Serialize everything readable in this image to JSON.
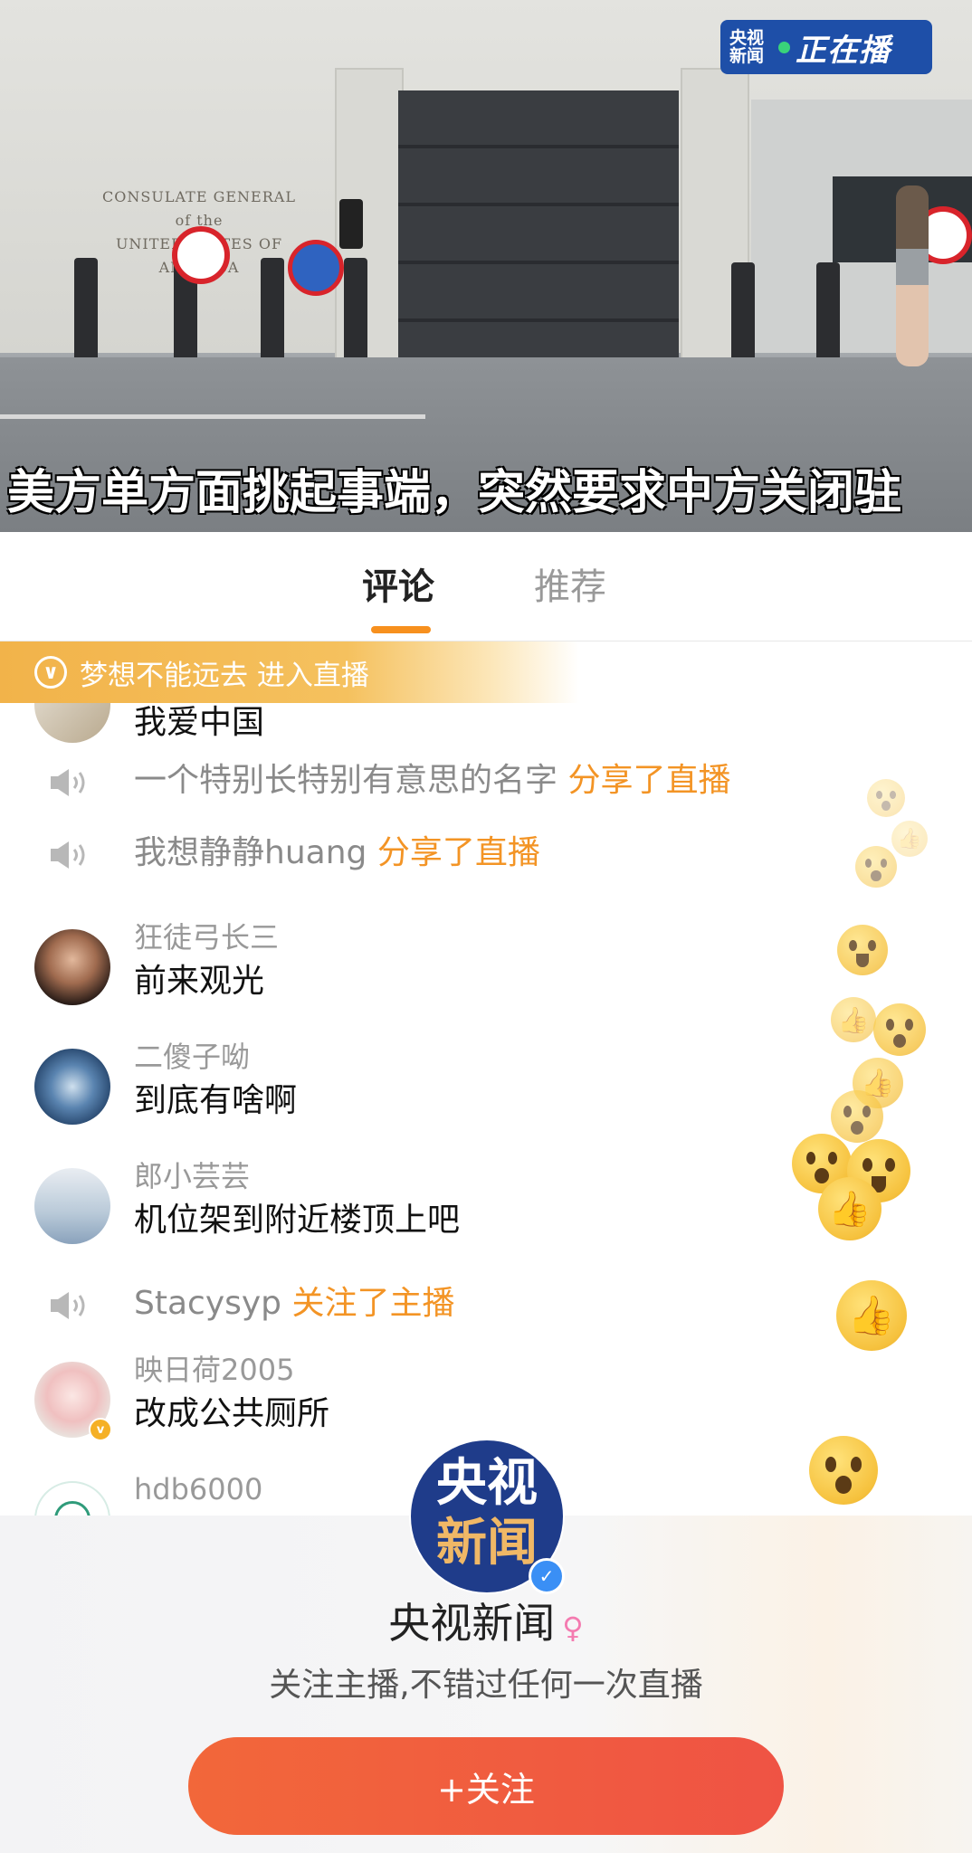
{
  "video": {
    "live_badge_logo": "央视\n新闻",
    "live_badge_text": "正在播",
    "plaque_line1": "CONSULATE GENERAL",
    "plaque_line2": "of the",
    "plaque_line3": "UNITED STATES OF AMERICA",
    "caption": "美方单方面挑起事端，突然要求中方关闭驻"
  },
  "tabs": {
    "comments": "评论",
    "recommend": "推荐",
    "active": "评论"
  },
  "banner": {
    "text": "梦想不能远去 进入直播",
    "icon": "chevron-down-circle-icon"
  },
  "feed": {
    "partial_top_message": "我爱中国",
    "system_1": {
      "user": "一个特别长特别有意思的名字",
      "action": "分享了直播",
      "icon": "speaker-icon"
    },
    "system_2": {
      "user": "我想静静huang",
      "action": "分享了直播",
      "icon": "speaker-icon"
    },
    "comment_1": {
      "user": "狂徒弓长三",
      "message": "前来观光"
    },
    "comment_2": {
      "user": "二傻子呦",
      "message": "到底有啥啊"
    },
    "comment_3": {
      "user": "郎小芸芸",
      "message": "机位架到附近楼顶上吧"
    },
    "system_3": {
      "user": "Stacysyp",
      "action": "关注了主播",
      "icon": "speaker-icon"
    },
    "comment_4": {
      "user": "映日荷2005",
      "message": "改成公共厕所"
    },
    "comment_5": {
      "user": "hdb6000",
      "message": ""
    }
  },
  "profile": {
    "avatar_line1": "央视",
    "avatar_line2": "新闻",
    "name": "央视新闻",
    "gender_icon": "♀",
    "subtitle": "关注主播,不错过任何一次直播",
    "follow_label": "+关注"
  },
  "colors": {
    "accent_orange": "#f39425",
    "follow_button": "#ef5344",
    "banner": "#f2b34a",
    "verified_blue": "#3a8ff5"
  }
}
